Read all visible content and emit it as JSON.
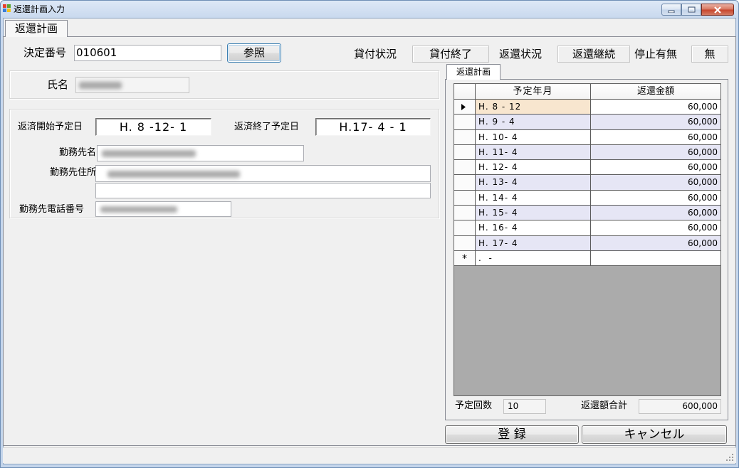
{
  "window": {
    "title": "返還計画入力",
    "app_icon": "app-icon",
    "controls": [
      "minimize-icon",
      "maximize-icon",
      "close-icon"
    ]
  },
  "main_tab": {
    "label": "返還計画"
  },
  "header": {
    "decision_no_label": "決定番号",
    "decision_no_value": "010601",
    "reference_button": "参照",
    "loan_status_label": "貸付状況",
    "loan_status_value": "貸付終了",
    "repayment_status_label": "返還状況",
    "repayment_status_value": "返還継続",
    "suspension_label": "停止有無",
    "suspension_value": "無"
  },
  "person": {
    "name_label": "氏名"
  },
  "details": {
    "start_date_label": "返済開始予定日",
    "start_date_value": "H. 8 -12- 1",
    "end_date_label": "返済終了予定日",
    "end_date_value": "H.17- 4 - 1",
    "employer_label": "勤務先名",
    "employer_address_label": "勤務先住所",
    "employer_phone_label": "勤務先電話番号"
  },
  "plan": {
    "tab_label": "返還計画",
    "columns": {
      "date": "予定年月",
      "amount": "返還金額"
    },
    "rows": [
      {
        "date": "H. 8 - 12",
        "amount": "60,000"
      },
      {
        "date": "H. 9 - 4",
        "amount": "60,000"
      },
      {
        "date": "H. 10- 4",
        "amount": "60,000"
      },
      {
        "date": "H. 11- 4",
        "amount": "60,000"
      },
      {
        "date": "H. 12- 4",
        "amount": "60,000"
      },
      {
        "date": "H. 13- 4",
        "amount": "60,000"
      },
      {
        "date": "H. 14- 4",
        "amount": "60,000"
      },
      {
        "date": "H. 15- 4",
        "amount": "60,000"
      },
      {
        "date": "H. 16- 4",
        "amount": "60,000"
      },
      {
        "date": "H. 17- 4",
        "amount": "60,000"
      }
    ],
    "current_row_icon": "current-row-indicator-icon",
    "new_row": {
      "marker": "*",
      "date": ".  -"
    },
    "count_label": "予定回数",
    "count_value": "10",
    "total_label": "返還額合計",
    "total_value": "600,000"
  },
  "buttons": {
    "register": "登 録",
    "cancel": "キャンセル"
  },
  "status_bar": {
    "grip_icon": "resize-grip-icon"
  },
  "colors": {
    "selected_cell": "#f8e6cf",
    "alternate_row": "#e6e6f5",
    "grid_empty_area": "#ababab",
    "close_button": "#c7432b"
  }
}
